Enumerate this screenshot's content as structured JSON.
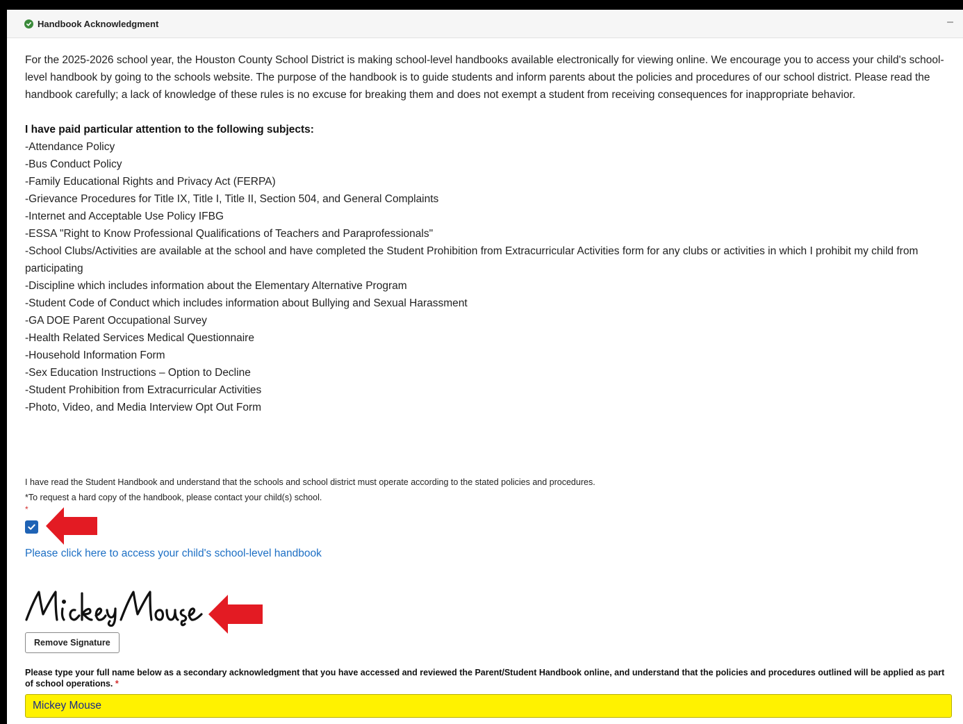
{
  "header": {
    "title": "Handbook Acknowledgment",
    "collapse_symbol": "–",
    "status_icon": "check-circle-icon",
    "status_color": "#3a8a3a"
  },
  "intro_paragraph": "For the 2025-2026 school year, the Houston County School District is making school-level handbooks available electronically for viewing online. We encourage you to access your child's school-level handbook by going to the schools website. The purpose of the handbook is to guide students and inform parents about the policies and procedures of our school district. Please read the handbook carefully; a lack of knowledge of these rules is no excuse for breaking them and does not exempt a student from receiving consequences for inappropriate behavior.",
  "subjects_heading": "I have paid particular attention to the following subjects:",
  "subjects": [
    "-Attendance Policy",
    "-Bus Conduct Policy",
    "-Family Educational Rights and Privacy Act (FERPA)",
    "-Grievance Procedures for Title IX, Title I, Title II, Section 504, and General Complaints",
    "-Internet and Acceptable Use Policy IFBG",
    "-ESSA \"Right to Know Professional Qualifications of Teachers and Paraprofessionals\"",
    "-School Clubs/Activities are available at the school and have completed the Student Prohibition from Extracurricular Activities form for any clubs or activities in which I prohibit my child from participating",
    "-Discipline which includes information about the Elementary Alternative Program",
    "-Student Code of Conduct which includes information about Bullying and Sexual Harassment",
    "-GA DOE Parent Occupational Survey",
    "-Health Related Services Medical Questionnaire",
    "-Household Information Form",
    "-Sex Education Instructions – Option to Decline",
    "-Student Prohibition from Extracurricular Activities",
    "-Photo, Video, and Media Interview Opt Out Form"
  ],
  "acknowledgment": {
    "statement": "I have read the Student Handbook and understand that the schools and school district must operate according to the stated policies and procedures.",
    "hard_copy_note": "*To request a hard copy of the handbook, please contact your child(s) school.",
    "required_marker": "*",
    "checked": true,
    "checkbox_color": "#1f63b5"
  },
  "handbook_link": "Please click here to access your child's school-level handbook",
  "signature": {
    "signed_name": "Mickey Mouse",
    "remove_label": "Remove Signature"
  },
  "typed_name": {
    "label": "Please type your full name below as a secondary acknowledgment that you have accessed and reviewed the Parent/Student Handbook online, and understand that the policies and procedures outlined will be applied as part of school operations.",
    "required_marker": "*",
    "value": "Mickey Mouse",
    "highlight_color": "#fff200"
  },
  "annotation_arrow_color": "#e31b23"
}
